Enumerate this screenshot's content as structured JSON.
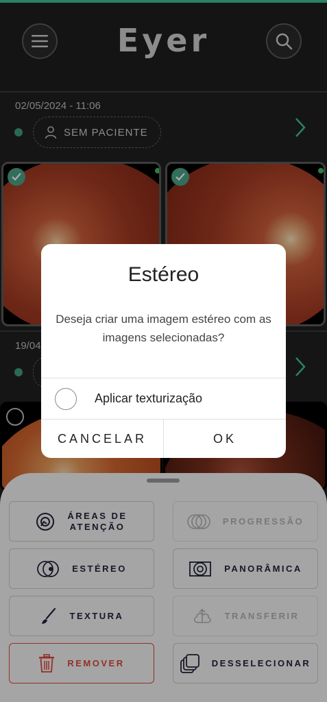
{
  "app": {
    "logo": "Eyer"
  },
  "sessions": [
    {
      "date": "02/05/2024 - 11:06",
      "patient_label": "SEM PACIENTE"
    },
    {
      "date": "19/04"
    }
  ],
  "actions": {
    "areas_line1": "ÁREAS DE",
    "areas_line2": "ATENÇÃO",
    "progressao": "PROGRESSÃO",
    "estereo": "ESTÉREO",
    "panoramica": "PANORÂMICA",
    "textura": "TEXTURA",
    "transferir": "TRANSFERIR",
    "remover": "REMOVER",
    "desselecionar": "DESSELECIONAR"
  },
  "dialog": {
    "title": "Estéreo",
    "message": "Deseja criar uma imagem estéreo com as imagens selecionadas?",
    "option_label": "Aplicar texturização",
    "option_checked": false,
    "cancel": "CANCELAR",
    "ok": "OK"
  },
  "colors": {
    "accent": "#3fbf92",
    "danger": "#d9483b",
    "text_dark": "#22223b"
  }
}
